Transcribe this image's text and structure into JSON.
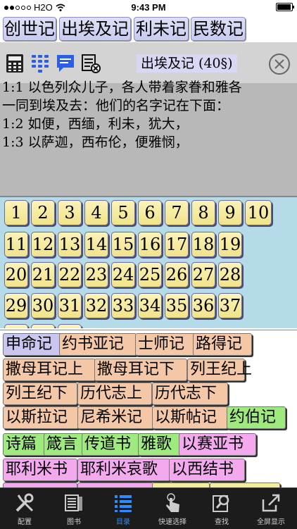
{
  "status": {
    "carrier": "H2O",
    "time": "9:43 PM"
  },
  "book_tabs": [
    "创世记",
    "出埃及记",
    "利未记",
    "民数记"
  ],
  "reader": {
    "title": "出埃及记 (40§)",
    "verses": [
      "1:1  以色列众儿子，各人带着家眷和雅各",
      "一同到埃及去：他们的名字记在下面：",
      "1:2  如便，西缅，利未，犹大，",
      "1:3  以萨迦，西布伦，便雅悯，"
    ]
  },
  "chapters": [
    "1",
    "2",
    "3",
    "4",
    "5",
    "6",
    "7",
    "8",
    "9",
    "10",
    "11",
    "12",
    "13",
    "14",
    "15",
    "16",
    "17",
    "18",
    "19",
    "20",
    "21",
    "22",
    "23",
    "24",
    "25",
    "26",
    "27",
    "28",
    "29",
    "30",
    "31",
    "32",
    "33",
    "34",
    "35",
    "36",
    "37"
  ],
  "books": [
    {
      "name": "申命记",
      "color": "blue"
    },
    {
      "name": "约书亚记",
      "color": "tan"
    },
    {
      "name": "士师记",
      "color": "tan"
    },
    {
      "name": "路得记",
      "color": "tan"
    },
    {
      "name": "撒母耳记上",
      "color": "tan"
    },
    {
      "name": "撒母耳记下",
      "color": "tan"
    },
    {
      "name": "列王纪上",
      "color": "tan"
    },
    {
      "name": "列王纪下",
      "color": "tan"
    },
    {
      "name": "历代志上",
      "color": "tan"
    },
    {
      "name": "历代志下",
      "color": "tan"
    },
    {
      "name": "以斯拉记",
      "color": "tan"
    },
    {
      "name": "尼希米记",
      "color": "tan"
    },
    {
      "name": "以斯帖记",
      "color": "tan"
    },
    {
      "name": "约伯记",
      "color": "green"
    },
    {
      "name": "诗篇",
      "color": "green"
    },
    {
      "name": "箴言",
      "color": "green"
    },
    {
      "name": "传道书",
      "color": "green"
    },
    {
      "name": "雅歌",
      "color": "green"
    },
    {
      "name": "以赛亚书",
      "color": "pink"
    },
    {
      "name": "耶利米书",
      "color": "pink"
    },
    {
      "name": "耶利米哀歌",
      "color": "pink"
    },
    {
      "name": "以西结书",
      "color": "pink"
    }
  ],
  "tabbar": [
    {
      "label": "配置",
      "icon": "wrench-screwdriver-icon"
    },
    {
      "label": "图书",
      "icon": "books-icon"
    },
    {
      "label": "目录",
      "icon": "list-icon",
      "active": true
    },
    {
      "label": "快速选择",
      "icon": "tap-hand-icon"
    },
    {
      "label": "查找",
      "icon": "search-icon"
    },
    {
      "label": "全屏显示",
      "icon": "fullscreen-icon"
    }
  ],
  "colors": {
    "active_tab": "#2f8cff",
    "grid_bg": "#b5dbe8",
    "chip": "#f0e38a"
  }
}
